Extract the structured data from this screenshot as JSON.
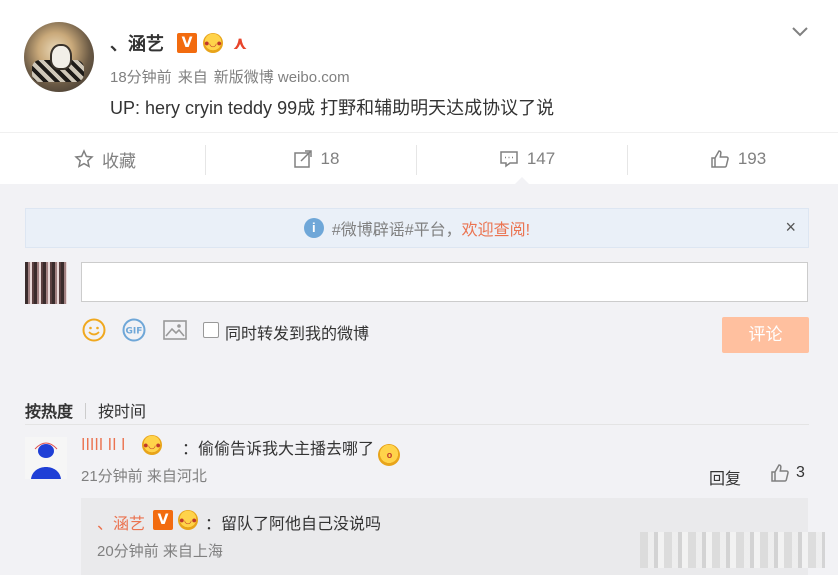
{
  "post": {
    "username": "、涵艺",
    "badge_v": "V",
    "time": "18分钟前",
    "source_prefix": "来自",
    "source": "新版微博 weibo.com",
    "text": "UP: hery cryin teddy 99成 打野和辅助明天达成协议了说"
  },
  "actions": {
    "favorite": "收藏",
    "forward_count": "18",
    "comment_count": "147",
    "like_count": "193"
  },
  "notice": {
    "text": "#微博辟谣#平台，",
    "link": "欢迎查阅!",
    "close": "×"
  },
  "composer": {
    "forward_label": "同时转发到我的微博",
    "submit_label": "评论",
    "input_value": ""
  },
  "sort": {
    "hot": "按热度",
    "time": "按时间"
  },
  "comment": {
    "author": "ⅼⅼⅼⅼⅼ ⅼⅼ ⅼ",
    "text": "：偷偷告诉我大主播去哪了",
    "time": "21分钟前",
    "location": "来自河北",
    "reply_label": "回复",
    "like_count": "3"
  },
  "sub_comment": {
    "author": "、涵艺",
    "badge_v": "V",
    "text": "：留队了阿他自己没说吗",
    "time": "20分钟前",
    "location": "来自上海"
  },
  "colors": {
    "accent": "#eb7350",
    "badge_orange": "#f26b0f",
    "submit_disabled": "#ffc09f",
    "panel_bg": "#f2f2f5"
  }
}
